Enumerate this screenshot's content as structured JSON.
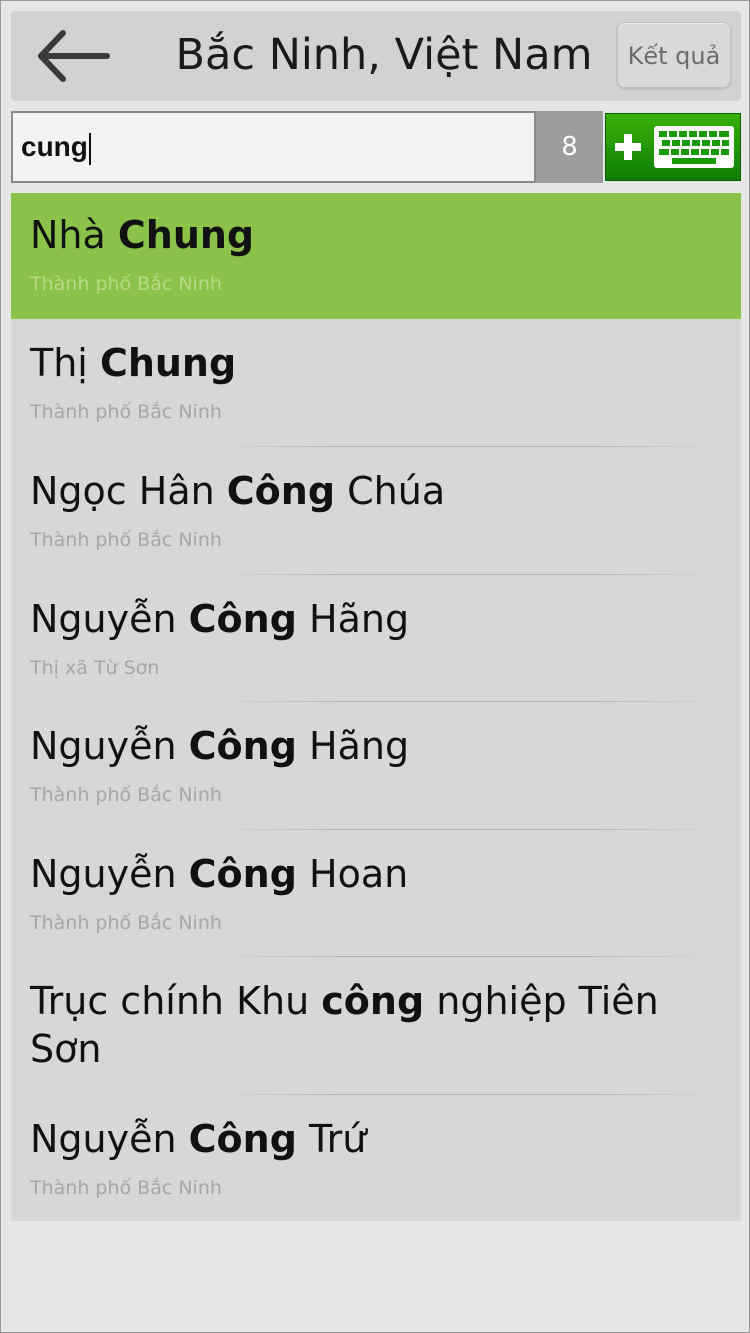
{
  "header": {
    "back_icon": "arrow-left-icon",
    "title": "Bắc Ninh, Việt Nam",
    "result_button": "Kết quả"
  },
  "search": {
    "value": "cung",
    "count": "8",
    "keyboard_icon": "plus-keyboard-icon"
  },
  "colors": {
    "selected": "#8bc34a",
    "keyboard_button": "#1a9a08",
    "list_bg": "#d7d7d7"
  },
  "results": [
    {
      "name_pre": "Nhà ",
      "name_bold": "Chung",
      "name_post": "",
      "sub": "Thành phố Bắc Ninh"
    },
    {
      "name_pre": "Thị ",
      "name_bold": "Chung",
      "name_post": "",
      "sub": "Thành phố Bắc Ninh"
    },
    {
      "name_pre": "Ngọc Hân ",
      "name_bold": "Công",
      "name_post": " Chúa",
      "sub": "Thành phố Bắc Ninh"
    },
    {
      "name_pre": "Nguyễn ",
      "name_bold": "Công",
      "name_post": " Hãng",
      "sub": "Thị xã Từ Sơn"
    },
    {
      "name_pre": "Nguyễn ",
      "name_bold": "Công",
      "name_post": " Hãng",
      "sub": "Thành phố Bắc Ninh"
    },
    {
      "name_pre": "Nguyễn ",
      "name_bold": "Công",
      "name_post": " Hoan",
      "sub": "Thành phố Bắc Ninh"
    },
    {
      "name_pre": "Trục chính Khu ",
      "name_bold": "công",
      "name_post": " nghiệp Tiên",
      "name_line2": "Sơn",
      "sub": ""
    },
    {
      "name_pre": "Nguyễn ",
      "name_bold": "Công",
      "name_post": " Trứ",
      "sub": "Thành phố Bắc Ninh"
    }
  ]
}
